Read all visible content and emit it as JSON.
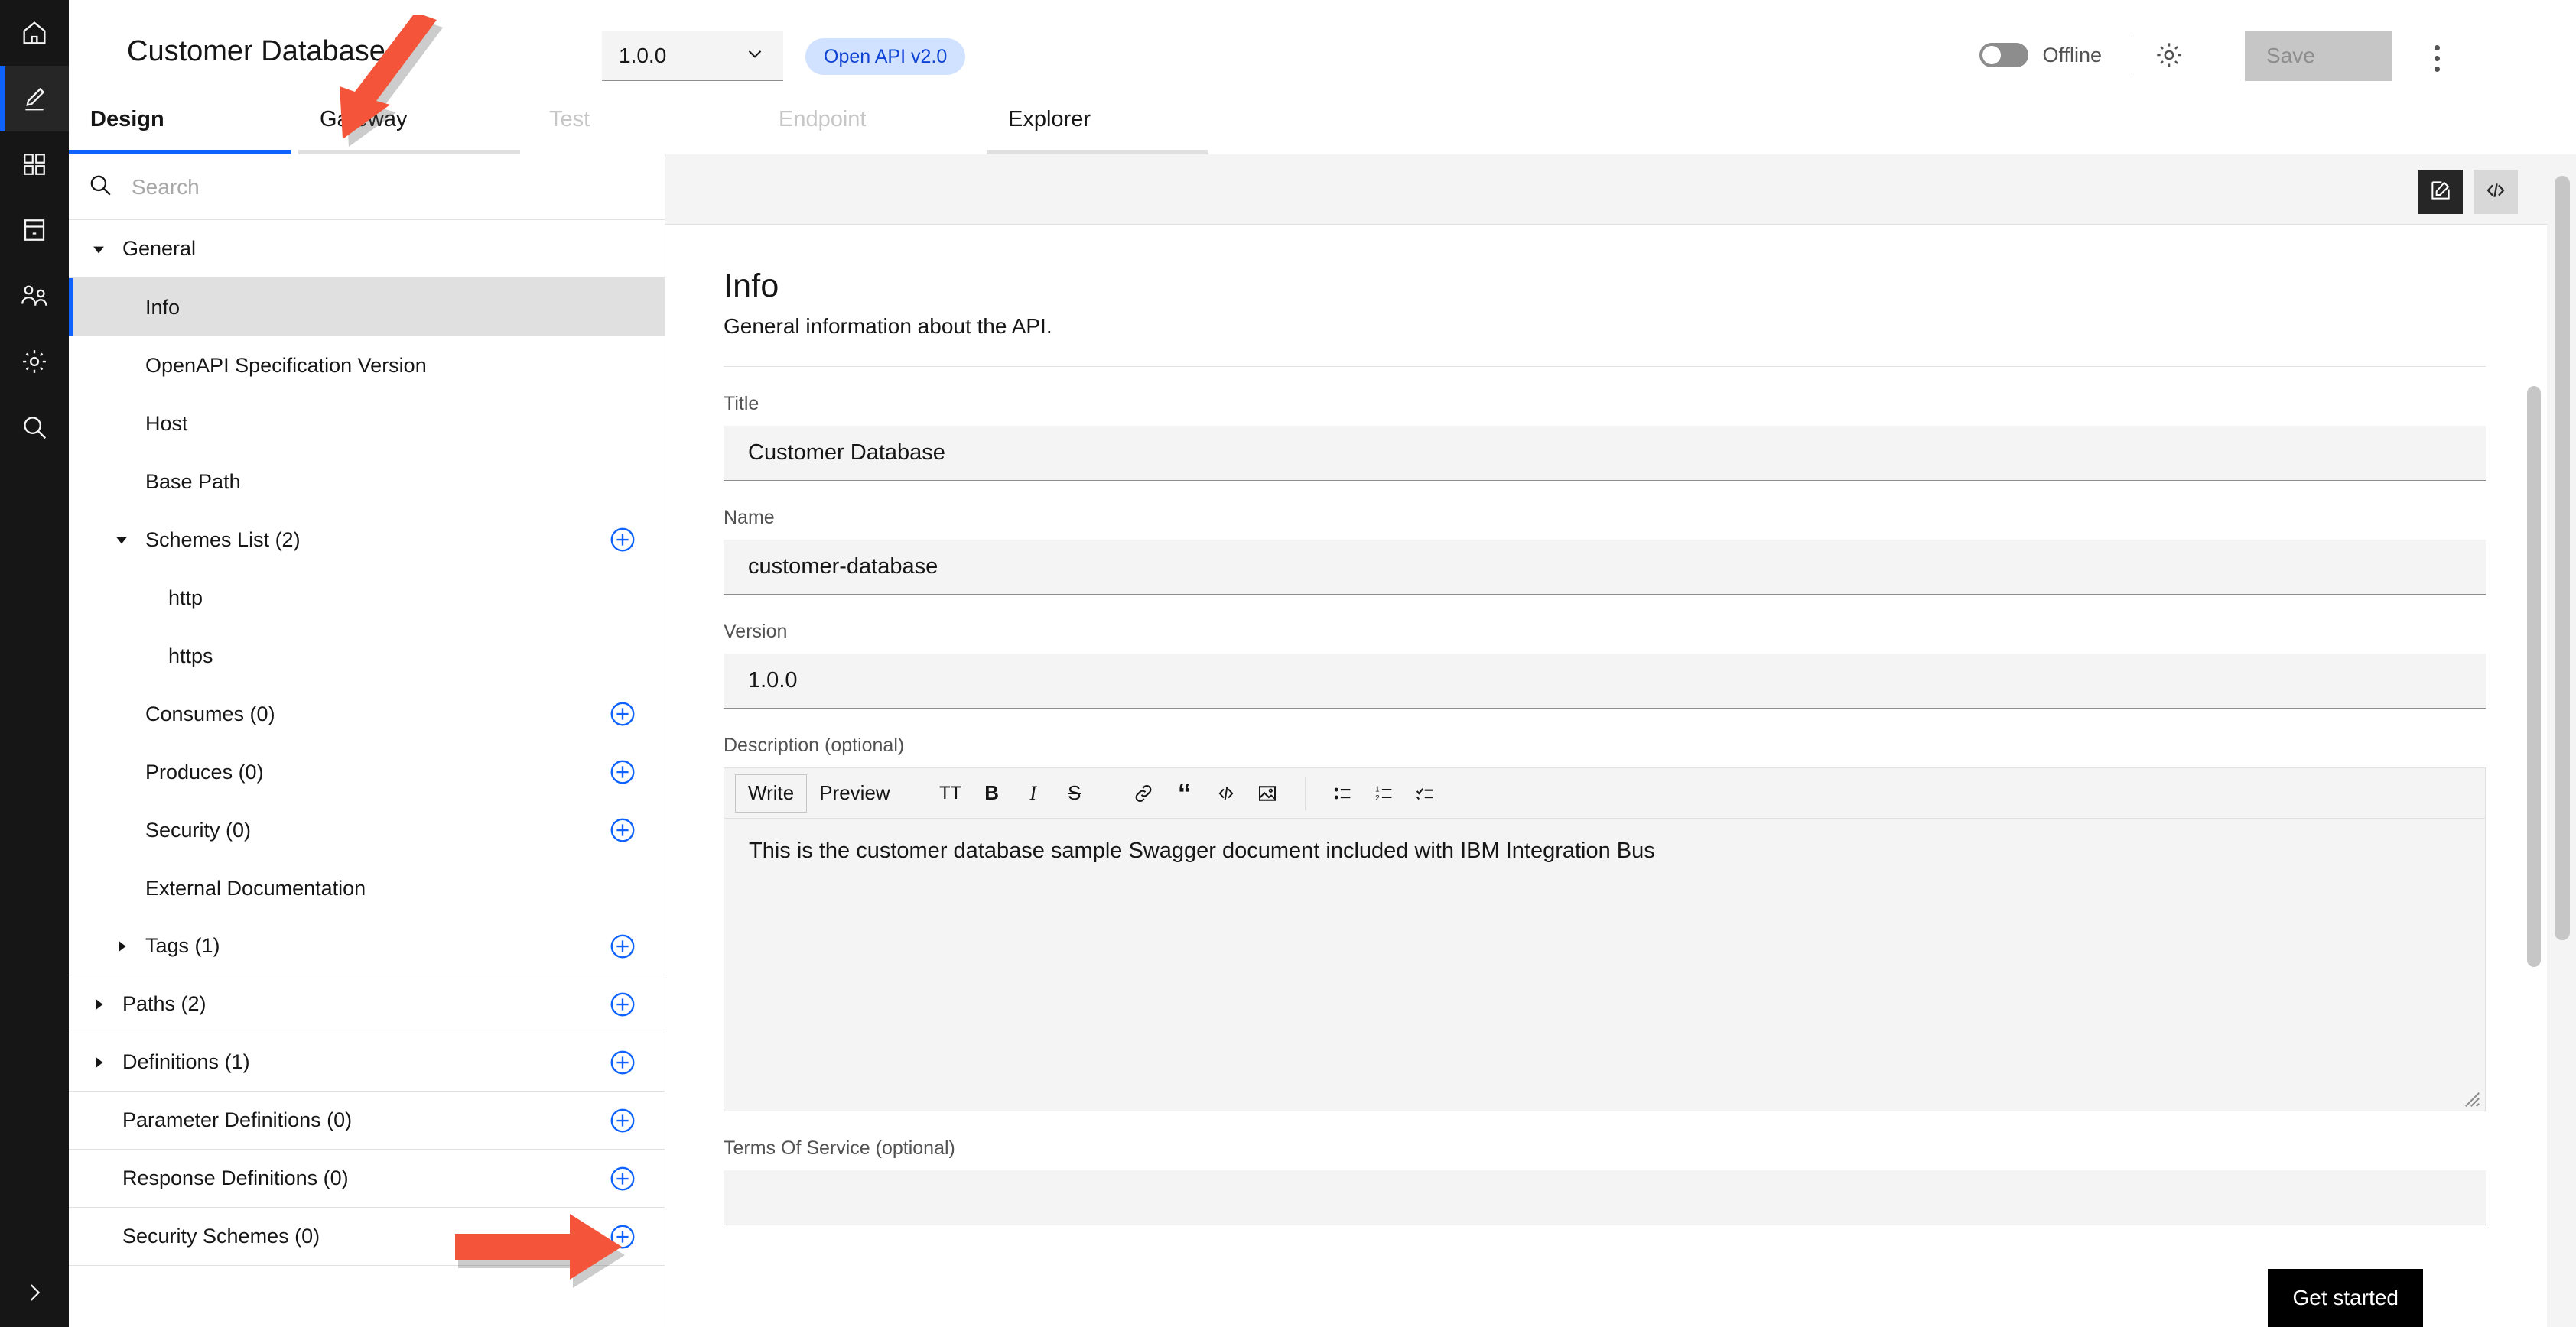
{
  "rail": {
    "items": [
      {
        "icon": "home-icon",
        "name": "home",
        "active": false
      },
      {
        "icon": "pencil-icon",
        "name": "design",
        "active": true
      },
      {
        "icon": "grid-icon",
        "name": "apps",
        "active": false
      },
      {
        "icon": "server-icon",
        "name": "catalog",
        "active": false
      },
      {
        "icon": "users-icon",
        "name": "members",
        "active": false
      },
      {
        "icon": "gear-icon",
        "name": "settings",
        "active": false
      },
      {
        "icon": "search-icon",
        "name": "search",
        "active": false
      }
    ],
    "expand_icon": "chevron-right-icon"
  },
  "header": {
    "title": "Customer Database",
    "version": "1.0.0",
    "version_caret_icon": "chevron-down-icon",
    "spec_badge": "Open API v2.0",
    "online_toggle_label": "Offline",
    "online_toggle_on": false,
    "settings_icon": "gear-icon",
    "save_label": "Save",
    "overflow_icon": "kebab-menu-icon"
  },
  "tabs": [
    {
      "label": "Design",
      "state": "active"
    },
    {
      "label": "Gateway",
      "state": "enabled"
    },
    {
      "label": "Test",
      "state": "disabled"
    },
    {
      "label": "Endpoint",
      "state": "disabled"
    },
    {
      "label": "Explorer",
      "state": "enabled"
    }
  ],
  "sidebar": {
    "search_placeholder": "Search",
    "search_icon": "search-icon",
    "tree": [
      {
        "label": "General",
        "indent": 0,
        "caret": "down",
        "add": false,
        "selected": false,
        "divider": true
      },
      {
        "label": "Info",
        "indent": 1,
        "caret": "none",
        "add": false,
        "selected": true,
        "divider": false
      },
      {
        "label": "OpenAPI Specification Version",
        "indent": 1,
        "caret": "none",
        "add": false,
        "selected": false,
        "divider": false
      },
      {
        "label": "Host",
        "indent": 1,
        "caret": "none",
        "add": false,
        "selected": false,
        "divider": false
      },
      {
        "label": "Base Path",
        "indent": 1,
        "caret": "none",
        "add": false,
        "selected": false,
        "divider": false
      },
      {
        "label": "Schemes List (2)",
        "indent": 1,
        "caret": "down",
        "add": true,
        "selected": false,
        "divider": false
      },
      {
        "label": "http",
        "indent": 2,
        "caret": "none",
        "add": false,
        "selected": false,
        "divider": false
      },
      {
        "label": "https",
        "indent": 2,
        "caret": "none",
        "add": false,
        "selected": false,
        "divider": false
      },
      {
        "label": "Consumes (0)",
        "indent": 1,
        "caret": "none",
        "add": true,
        "selected": false,
        "divider": false
      },
      {
        "label": "Produces (0)",
        "indent": 1,
        "caret": "none",
        "add": true,
        "selected": false,
        "divider": false
      },
      {
        "label": "Security (0)",
        "indent": 1,
        "caret": "none",
        "add": true,
        "selected": false,
        "divider": false
      },
      {
        "label": "External Documentation",
        "indent": 1,
        "caret": "none",
        "add": false,
        "selected": false,
        "divider": false
      },
      {
        "label": "Tags (1)",
        "indent": 1,
        "caret": "right",
        "add": true,
        "selected": false,
        "divider": true
      },
      {
        "label": "Paths (2)",
        "indent": 0,
        "caret": "right",
        "add": true,
        "selected": false,
        "divider": true
      },
      {
        "label": "Definitions (1)",
        "indent": 0,
        "caret": "right",
        "add": true,
        "selected": false,
        "divider": true
      },
      {
        "label": "Parameter Definitions (0)",
        "indent": 0,
        "caret": "none",
        "add": true,
        "selected": false,
        "divider": true
      },
      {
        "label": "Response Definitions (0)",
        "indent": 0,
        "caret": "none",
        "add": true,
        "selected": false,
        "divider": true
      },
      {
        "label": "Security Schemes (0)",
        "indent": 0,
        "caret": "none",
        "add": true,
        "selected": false,
        "divider": true
      }
    ]
  },
  "main": {
    "toolbar": {
      "edit_icon": "edit-document-icon",
      "code_icon": "source-code-icon"
    },
    "heading": "Info",
    "subheading": "General information about the API.",
    "fields": {
      "title_label": "Title",
      "title_value": "Customer Database",
      "name_label": "Name",
      "name_value": "customer-database",
      "version_label": "Version",
      "version_value": "1.0.0",
      "description_label": "Description (optional)",
      "description_value": "This is the customer database sample Swagger document included with IBM Integration Bus",
      "terms_label": "Terms Of Service (optional)",
      "terms_value": ""
    },
    "markdown_toolbar": {
      "write_label": "Write",
      "preview_label": "Preview",
      "icons": [
        {
          "glyph": "TT",
          "name": "heading-icon"
        },
        {
          "glyph": "B",
          "name": "bold-icon"
        },
        {
          "glyph": "I",
          "name": "italic-icon"
        },
        {
          "glyph": "S",
          "name": "strikethrough-icon"
        }
      ],
      "icons2": [
        {
          "glyph": "ὑ7",
          "name": "link-icon"
        },
        {
          "glyph": "“",
          "name": "quote-icon"
        },
        {
          "glyph": "</>",
          "name": "code-icon"
        },
        {
          "glyph": "IMG",
          "name": "image-icon"
        }
      ],
      "icons3": [
        {
          "glyph": "UL",
          "name": "bullet-list-icon"
        },
        {
          "glyph": "OL",
          "name": "numbered-list-icon"
        },
        {
          "glyph": "TL",
          "name": "task-list-icon"
        }
      ],
      "resize_grip": "resize-grip-icon"
    }
  },
  "footer": {
    "get_started_label": "Get started"
  },
  "colors": {
    "accent_blue": "#0f62fe",
    "badge_bg": "#d0e2ff",
    "badge_text": "#0f43d4",
    "rail_bg": "#161616",
    "field_bg": "#f4f4f4",
    "annotation_red": "#f4543a"
  }
}
